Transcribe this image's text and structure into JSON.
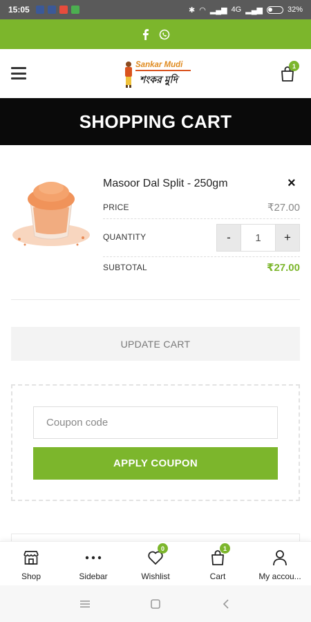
{
  "status_bar": {
    "time": "15:05",
    "network": "4G",
    "battery": "32%"
  },
  "header": {
    "logo_line1": "Sankar Mudi",
    "logo_line2": "শংকর মুদি",
    "cart_count": "1"
  },
  "banner": {
    "title": "SHOPPING CART"
  },
  "cart_item": {
    "name": "Masoor Dal Split - 250gm",
    "remove_symbol": "×",
    "price_label": "PRICE",
    "price": "₹27.00",
    "quantity_label": "QUANTITY",
    "quantity": "1",
    "minus": "-",
    "plus": "+",
    "subtotal_label": "SUBTOTAL",
    "subtotal": "₹27.00"
  },
  "actions": {
    "update_cart": "UPDATE CART",
    "coupon_placeholder": "Coupon code",
    "apply_coupon": "APPLY COUPON"
  },
  "bottom_nav": {
    "items": [
      {
        "label": "Shop",
        "icon": "store-icon"
      },
      {
        "label": "Sidebar",
        "icon": "more-dots-icon"
      },
      {
        "label": "Wishlist",
        "icon": "heart-icon",
        "badge": "0"
      },
      {
        "label": "Cart",
        "icon": "bag-icon",
        "badge": "1"
      },
      {
        "label": "My accou...",
        "icon": "user-icon"
      }
    ]
  },
  "colors": {
    "brand_green": "#7cb62c",
    "banner_black": "#0a0a0a",
    "status_gray": "#5a5a5a"
  }
}
